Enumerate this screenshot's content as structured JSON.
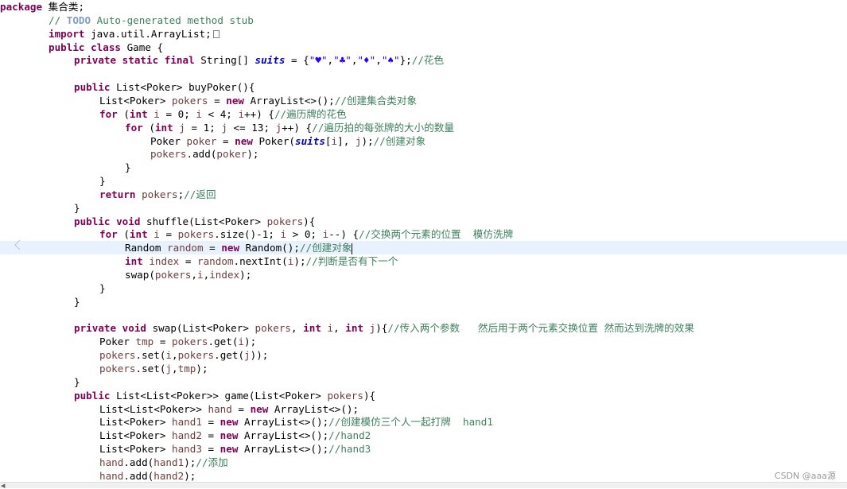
{
  "code": {
    "lines": [
      [
        [
          "kw",
          "package"
        ],
        [
          "t",
          " 集合类;"
        ]
      ],
      [
        [
          "cm",
          "// "
        ],
        [
          "todo",
          "TODO"
        ],
        [
          "cm",
          " Auto-generated method stub"
        ]
      ],
      [
        [
          "kw",
          "import"
        ],
        [
          "t",
          " java.util.ArrayList;"
        ],
        [
          "marker",
          ""
        ]
      ],
      [
        [
          "kw",
          "public"
        ],
        [
          "t",
          " "
        ],
        [
          "kw",
          "class"
        ],
        [
          "t",
          " Game {"
        ]
      ],
      [
        [
          "kw",
          "private"
        ],
        [
          "t",
          " "
        ],
        [
          "kw",
          "static"
        ],
        [
          "t",
          " "
        ],
        [
          "kw",
          "final"
        ],
        [
          "t",
          " String[] "
        ],
        [
          "sfld",
          "suits"
        ],
        [
          "t",
          " = {"
        ],
        [
          "st",
          "\"♥\""
        ],
        [
          "t",
          ","
        ],
        [
          "st",
          "\"♣\""
        ],
        [
          "t",
          ","
        ],
        [
          "st",
          "\"♦\""
        ],
        [
          "t",
          ","
        ],
        [
          "st",
          "\"♠\""
        ],
        [
          "t",
          "};"
        ],
        [
          "cm",
          "//花色"
        ]
      ],
      [],
      [
        [
          "kw",
          "public"
        ],
        [
          "t",
          " List<Poker> buyPoker(){"
        ]
      ],
      [
        [
          "t",
          "List<Poker> "
        ],
        [
          "var",
          "pokers"
        ],
        [
          "t",
          " = "
        ],
        [
          "kw",
          "new"
        ],
        [
          "t",
          " ArrayList<>();"
        ],
        [
          "cm",
          "//创建集合类对象"
        ]
      ],
      [
        [
          "kw",
          "for"
        ],
        [
          "t",
          " ("
        ],
        [
          "kw",
          "int"
        ],
        [
          "t",
          " "
        ],
        [
          "var",
          "i"
        ],
        [
          "t",
          " = 0; "
        ],
        [
          "var",
          "i"
        ],
        [
          "t",
          " < 4; "
        ],
        [
          "var",
          "i"
        ],
        [
          "t",
          "++) {"
        ],
        [
          "cm",
          "//遍历牌的花色"
        ]
      ],
      [
        [
          "kw",
          "for"
        ],
        [
          "t",
          " ("
        ],
        [
          "kw",
          "int"
        ],
        [
          "t",
          " "
        ],
        [
          "var",
          "j"
        ],
        [
          "t",
          " = 1; "
        ],
        [
          "var",
          "j"
        ],
        [
          "t",
          " <= 13; "
        ],
        [
          "var",
          "j"
        ],
        [
          "t",
          "++) {"
        ],
        [
          "cm",
          "//遍历拍的每张牌的大小的数量"
        ]
      ],
      [
        [
          "t",
          "Poker "
        ],
        [
          "var",
          "poker"
        ],
        [
          "t",
          " = "
        ],
        [
          "kw",
          "new"
        ],
        [
          "t",
          " Poker("
        ],
        [
          "sfld",
          "suits"
        ],
        [
          "t",
          "["
        ],
        [
          "var",
          "i"
        ],
        [
          "t",
          "], "
        ],
        [
          "var",
          "j"
        ],
        [
          "t",
          ");"
        ],
        [
          "cm",
          "//创建对象"
        ]
      ],
      [
        [
          "var",
          "pokers"
        ],
        [
          "t",
          ".add("
        ],
        [
          "var",
          "poker"
        ],
        [
          "t",
          ");"
        ]
      ],
      [
        [
          "t",
          "}"
        ]
      ],
      [
        [
          "t",
          "}"
        ]
      ],
      [
        [
          "kw",
          "return"
        ],
        [
          "t",
          " "
        ],
        [
          "var",
          "pokers"
        ],
        [
          "t",
          ";"
        ],
        [
          "cm",
          "//返回"
        ]
      ],
      [
        [
          "t",
          "}"
        ]
      ],
      [
        [
          "kw",
          "public"
        ],
        [
          "t",
          " "
        ],
        [
          "kw",
          "void"
        ],
        [
          "t",
          " shuffle(List<Poker> "
        ],
        [
          "var",
          "pokers"
        ],
        [
          "t",
          "){"
        ]
      ],
      [
        [
          "kw",
          "for"
        ],
        [
          "t",
          " ("
        ],
        [
          "kw",
          "int"
        ],
        [
          "t",
          " "
        ],
        [
          "var",
          "i"
        ],
        [
          "t",
          " = "
        ],
        [
          "var",
          "pokers"
        ],
        [
          "t",
          ".size()-1; "
        ],
        [
          "var",
          "i"
        ],
        [
          "t",
          " > 0; "
        ],
        [
          "var",
          "i"
        ],
        [
          "t",
          "--) {"
        ],
        [
          "cm",
          "//交换两个元素的位置  模仿洗牌"
        ]
      ],
      [
        [
          "t",
          "Random "
        ],
        [
          "var",
          "random"
        ],
        [
          "t",
          " = "
        ],
        [
          "kw",
          "new"
        ],
        [
          "t",
          " Random();"
        ],
        [
          "cm",
          "//创建对象"
        ],
        [
          "caret",
          ""
        ]
      ],
      [
        [
          "kw",
          "int"
        ],
        [
          "t",
          " "
        ],
        [
          "var",
          "index"
        ],
        [
          "t",
          " = "
        ],
        [
          "var",
          "random"
        ],
        [
          "t",
          ".nextInt("
        ],
        [
          "var",
          "i"
        ],
        [
          "t",
          ");"
        ],
        [
          "cm",
          "//判断是否有下一个"
        ]
      ],
      [
        [
          "t",
          "swap("
        ],
        [
          "var",
          "pokers"
        ],
        [
          "t",
          ","
        ],
        [
          "var",
          "i"
        ],
        [
          "t",
          ","
        ],
        [
          "var",
          "index"
        ],
        [
          "t",
          ");"
        ]
      ],
      [
        [
          "t",
          "}"
        ]
      ],
      [
        [
          "t",
          "}"
        ]
      ],
      [],
      [
        [
          "kw",
          "private"
        ],
        [
          "t",
          " "
        ],
        [
          "kw",
          "void"
        ],
        [
          "t",
          " swap(List<Poker> "
        ],
        [
          "var",
          "pokers"
        ],
        [
          "t",
          ", "
        ],
        [
          "kw",
          "int"
        ],
        [
          "t",
          " "
        ],
        [
          "var",
          "i"
        ],
        [
          "t",
          ", "
        ],
        [
          "kw",
          "int"
        ],
        [
          "t",
          " "
        ],
        [
          "var",
          "j"
        ],
        [
          "t",
          "){"
        ],
        [
          "cm",
          "//传入两个参数   然后用于两个元素交换位置 然而达到洗牌的效果"
        ]
      ],
      [
        [
          "t",
          "Poker "
        ],
        [
          "var",
          "tmp"
        ],
        [
          "t",
          " = "
        ],
        [
          "var",
          "pokers"
        ],
        [
          "t",
          ".get("
        ],
        [
          "var",
          "i"
        ],
        [
          "t",
          ");"
        ]
      ],
      [
        [
          "var",
          "pokers"
        ],
        [
          "t",
          ".set("
        ],
        [
          "var",
          "i"
        ],
        [
          "t",
          ","
        ],
        [
          "var",
          "pokers"
        ],
        [
          "t",
          ".get("
        ],
        [
          "var",
          "j"
        ],
        [
          "t",
          "));"
        ]
      ],
      [
        [
          "var",
          "pokers"
        ],
        [
          "t",
          ".set("
        ],
        [
          "var",
          "j"
        ],
        [
          "t",
          ","
        ],
        [
          "var",
          "tmp"
        ],
        [
          "t",
          ");"
        ]
      ],
      [
        [
          "t",
          "}"
        ]
      ],
      [
        [
          "kw",
          "public"
        ],
        [
          "t",
          " List<List<Poker>> game(List<Poker> "
        ],
        [
          "var",
          "pokers"
        ],
        [
          "t",
          "){"
        ]
      ],
      [
        [
          "t",
          "List<List<Poker>> "
        ],
        [
          "var",
          "hand"
        ],
        [
          "t",
          " = "
        ],
        [
          "kw",
          "new"
        ],
        [
          "t",
          " ArrayList<>();"
        ]
      ],
      [
        [
          "t",
          "List<Poker> "
        ],
        [
          "var",
          "hand1"
        ],
        [
          "t",
          " = "
        ],
        [
          "kw",
          "new"
        ],
        [
          "t",
          " ArrayList<>();"
        ],
        [
          "cm",
          "//创建模仿三个人一起打牌  hand1"
        ]
      ],
      [
        [
          "t",
          "List<Poker> "
        ],
        [
          "var",
          "hand2"
        ],
        [
          "t",
          " = "
        ],
        [
          "kw",
          "new"
        ],
        [
          "t",
          " ArrayList<>();"
        ],
        [
          "cm",
          "//hand2"
        ]
      ],
      [
        [
          "t",
          "List<Poker> "
        ],
        [
          "var",
          "hand3"
        ],
        [
          "t",
          " = "
        ],
        [
          "kw",
          "new"
        ],
        [
          "t",
          " ArrayList<>();"
        ],
        [
          "cm",
          "//hand3"
        ]
      ],
      [
        [
          "var",
          "hand"
        ],
        [
          "t",
          ".add("
        ],
        [
          "var",
          "hand1"
        ],
        [
          "t",
          ");"
        ],
        [
          "cm",
          "//添加"
        ]
      ],
      [
        [
          "var",
          "hand"
        ],
        [
          "t",
          ".add("
        ],
        [
          "var",
          "hand2"
        ],
        [
          "t",
          ");"
        ]
      ]
    ]
  },
  "watermark": "CSDN @aaa源"
}
